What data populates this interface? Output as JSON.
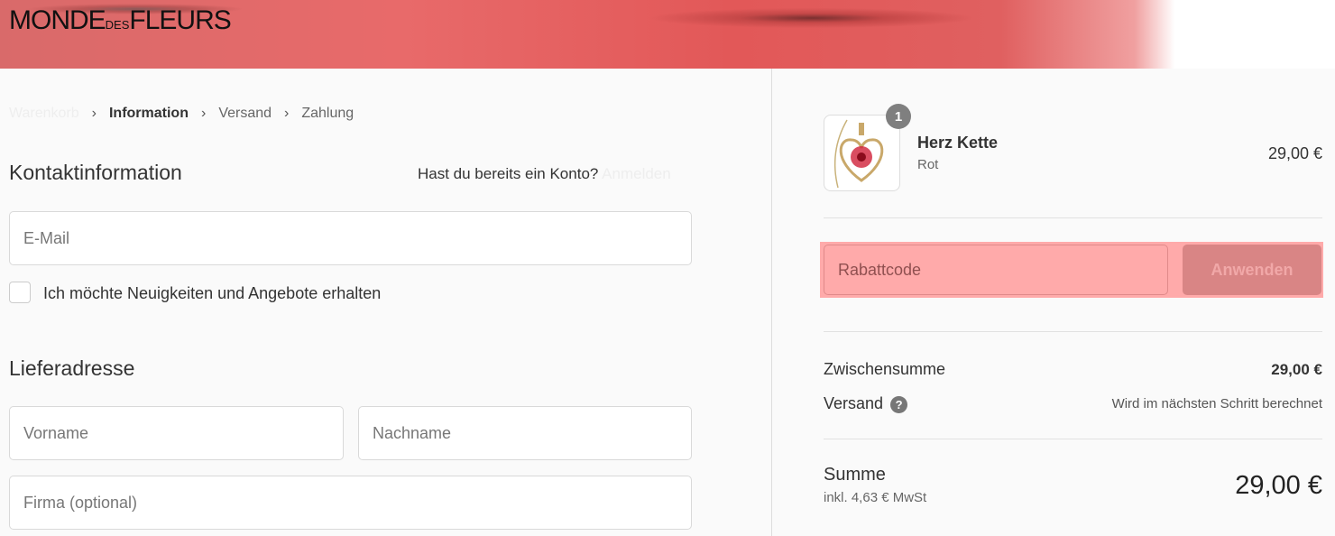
{
  "header": {
    "logo_main": "MONDE",
    "logo_small": "DES",
    "logo_end": "FLEURS"
  },
  "breadcrumb": [
    {
      "label": "Warenkorb"
    },
    {
      "label": "Information"
    },
    {
      "label": "Versand"
    },
    {
      "label": "Zahlung"
    }
  ],
  "contact": {
    "title": "Kontaktinformation",
    "account_prompt": "Hast du bereits ein Konto?",
    "login_link": "Anmelden",
    "email_placeholder": "E-Mail",
    "newsletter_label": "Ich möchte Neuigkeiten und Angebote erhalten",
    "newsletter_checked": false
  },
  "shipping": {
    "title": "Lieferadresse",
    "first_name_placeholder": "Vorname",
    "last_name_placeholder": "Nachname",
    "company_placeholder": "Firma (optional)"
  },
  "order": {
    "item": {
      "quantity": "1",
      "name": "Herz Kette",
      "variant": "Rot",
      "price": "29,00 €"
    },
    "discount_placeholder": "Rabattcode",
    "apply_label": "Anwenden",
    "subtotal_label": "Zwischensumme",
    "subtotal": "29,00 €",
    "shipping_label": "Versand",
    "shipping_value": "Wird im nächsten Schritt berechnet",
    "total_label": "Summe",
    "tax_note": "inkl. 4,63 € MwSt",
    "total": "29,00 €"
  },
  "colors": {
    "highlight": "#ffaaaa",
    "apply_button": "#d98585"
  }
}
